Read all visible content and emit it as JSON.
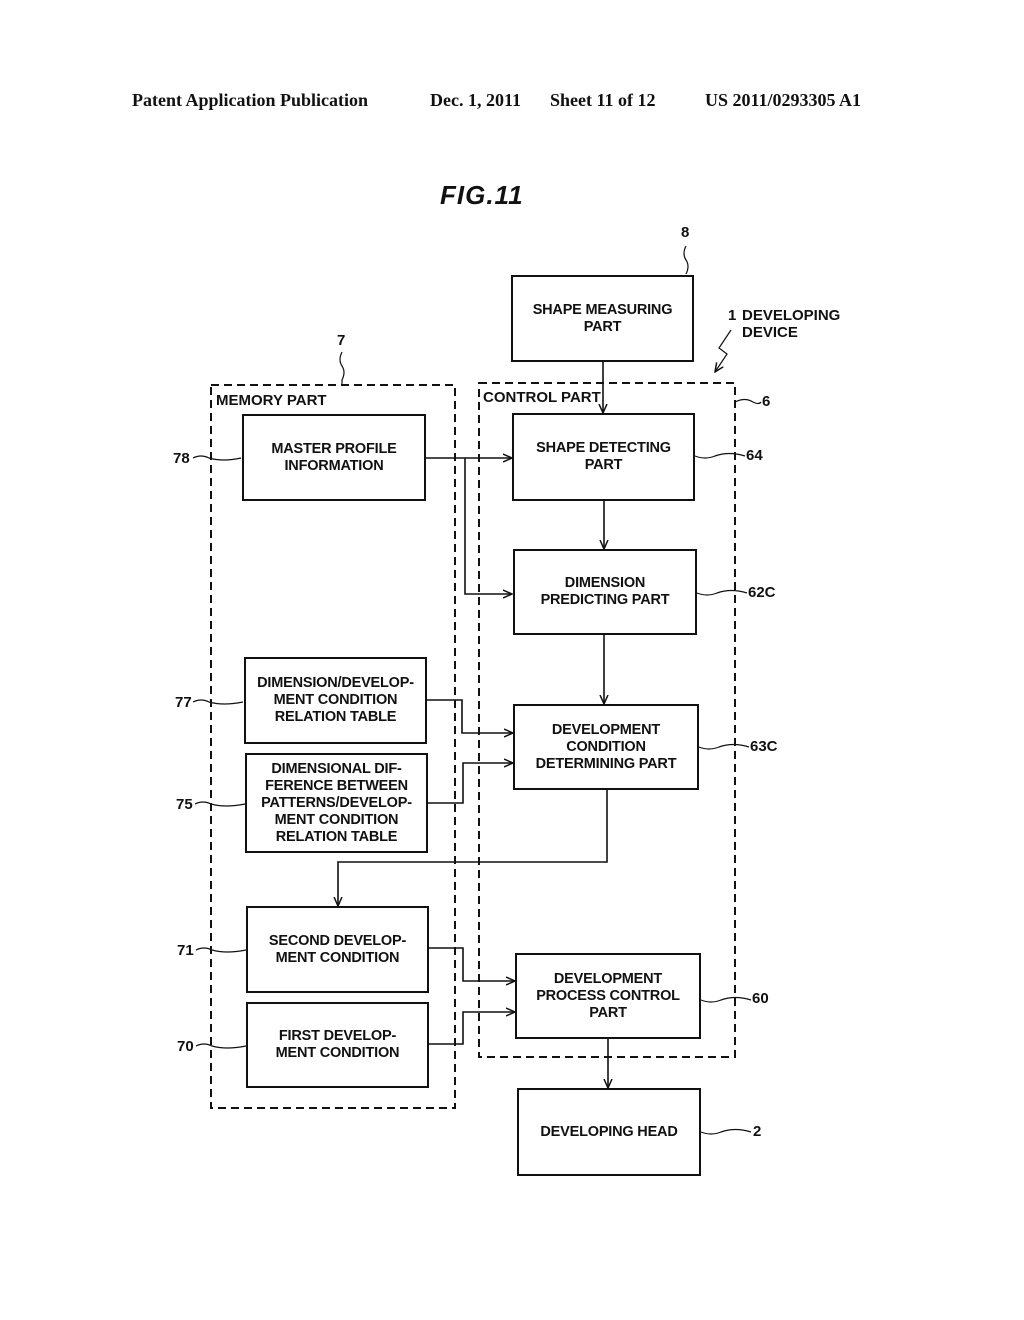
{
  "header": {
    "publication": "Patent Application Publication",
    "date": "Dec. 1, 2011",
    "sheet": "Sheet 11 of 12",
    "number": "US 2011/0293305 A1"
  },
  "figure": {
    "title": "FIG.11"
  },
  "device": {
    "ref": "1",
    "label": "DEVELOPING\nDEVICE"
  },
  "groups": {
    "memory": {
      "label": "MEMORY PART",
      "ref": "7"
    },
    "control": {
      "label": "CONTROL PART",
      "ref": "6"
    }
  },
  "blocks": {
    "shape_measuring": {
      "label": "SHAPE MEASURING\nPART",
      "ref": "8"
    },
    "master_profile": {
      "label": "MASTER PROFILE\nINFORMATION",
      "ref": "78"
    },
    "shape_detecting": {
      "label": "SHAPE DETECTING\nPART",
      "ref": "64"
    },
    "dimension_predicting": {
      "label": "DIMENSION\nPREDICTING PART",
      "ref": "62C"
    },
    "dim_dev_table": {
      "label": "DIMENSION/DEVELOP-\nMENT CONDITION\nRELATION TABLE",
      "ref": "77"
    },
    "dimdiff_table": {
      "label": "DIMENSIONAL DIF-\nFERENCE BETWEEN\nPATTERNS/DEVELOP-\nMENT CONDITION\nRELATION TABLE",
      "ref": "75"
    },
    "dev_condition_determining": {
      "label": "DEVELOPMENT\nCONDITION\nDETERMINING PART",
      "ref": "63C"
    },
    "second_dev_condition": {
      "label": "SECOND DEVELOP-\nMENT CONDITION",
      "ref": "71"
    },
    "first_dev_condition": {
      "label": "FIRST DEVELOP-\nMENT CONDITION",
      "ref": "70"
    },
    "dev_process_control": {
      "label": "DEVELOPMENT\nPROCESS CONTROL\nPART",
      "ref": "60"
    },
    "developing_head": {
      "label": "DEVELOPING HEAD",
      "ref": "2"
    }
  },
  "connections": [
    {
      "from": "shape_measuring",
      "to": "shape_detecting"
    },
    {
      "from": "master_profile",
      "to": "shape_detecting"
    },
    {
      "from": "master_profile",
      "to": "dimension_predicting"
    },
    {
      "from": "shape_detecting",
      "to": "dimension_predicting"
    },
    {
      "from": "dimension_predicting",
      "to": "dev_condition_determining"
    },
    {
      "from": "dim_dev_table",
      "to": "dev_condition_determining"
    },
    {
      "from": "dimdiff_table",
      "to": "dev_condition_determining"
    },
    {
      "from": "dev_condition_determining",
      "to": "second_dev_condition"
    },
    {
      "from": "second_dev_condition",
      "to": "dev_process_control"
    },
    {
      "from": "first_dev_condition",
      "to": "dev_process_control"
    },
    {
      "from": "dev_process_control",
      "to": "developing_head"
    }
  ]
}
